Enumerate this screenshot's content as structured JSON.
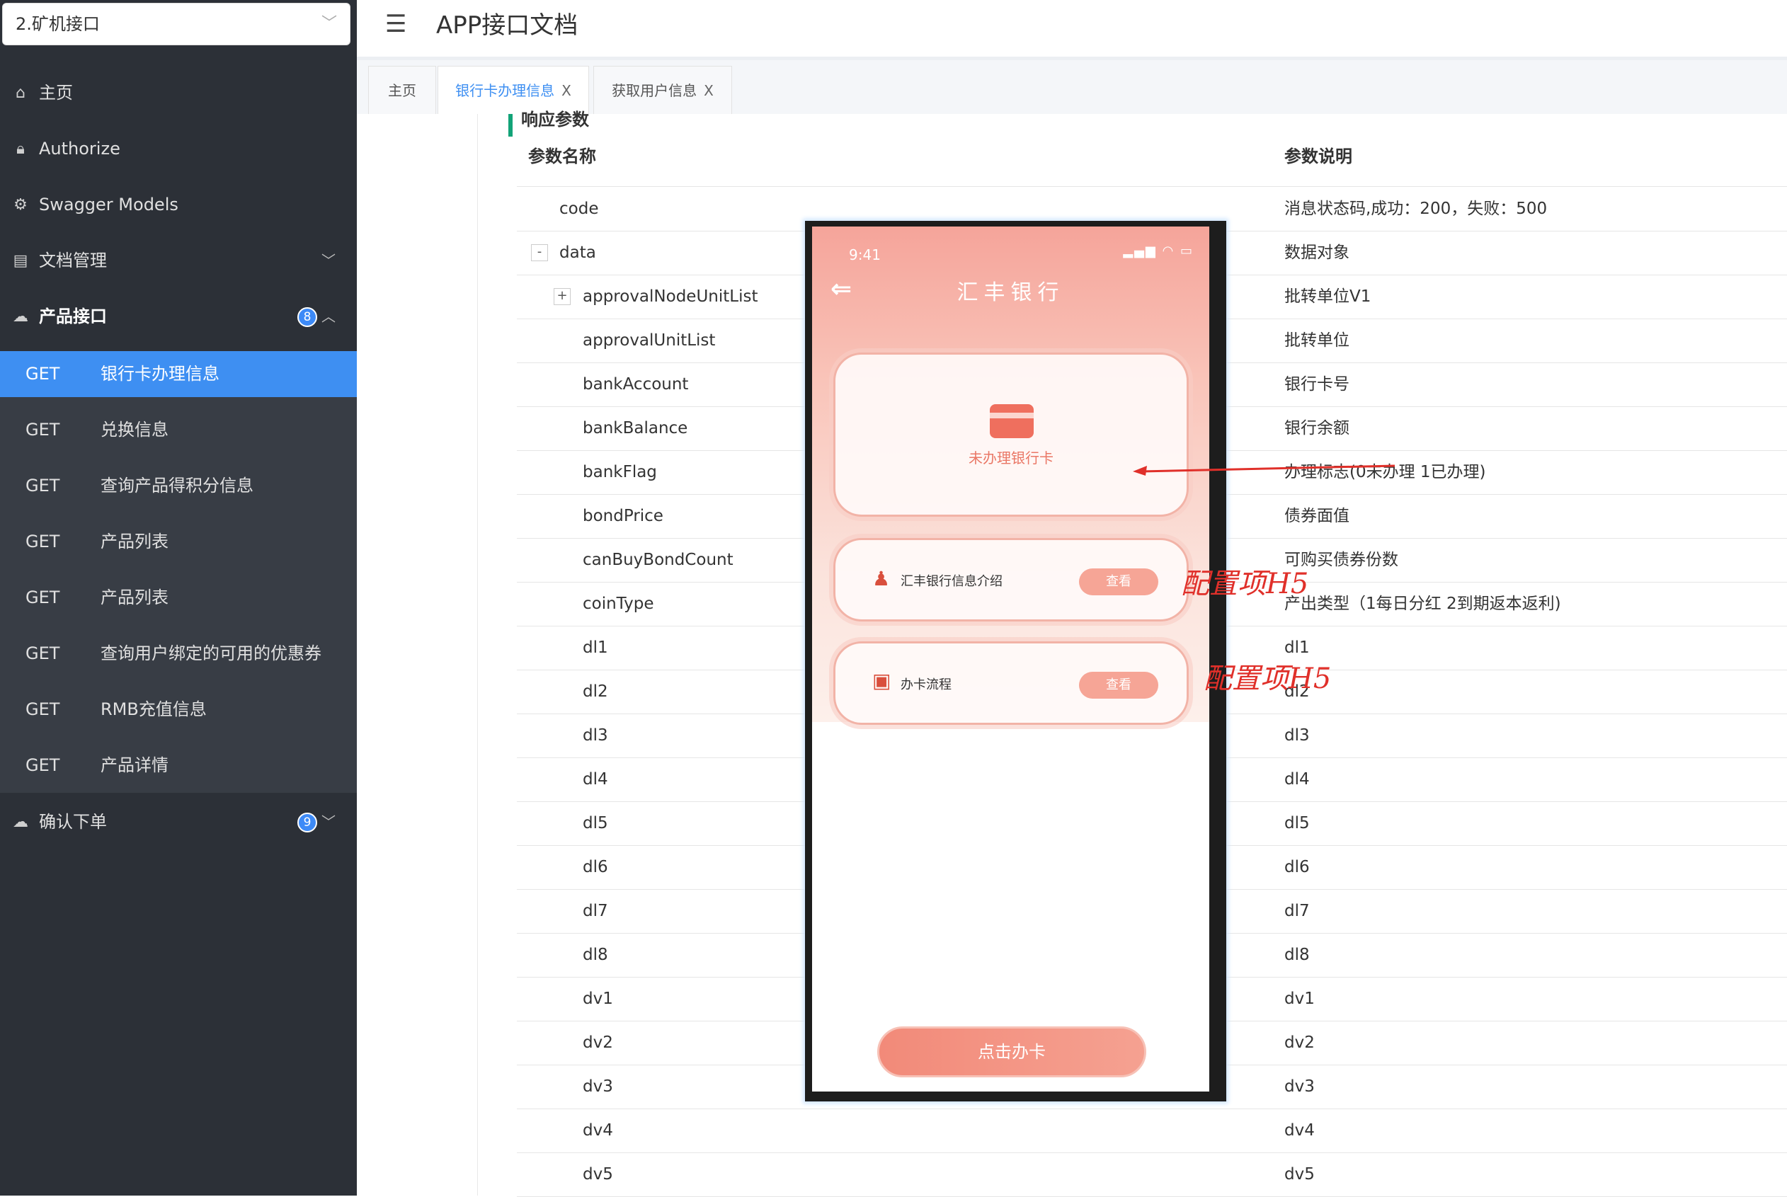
{
  "sidebar": {
    "select_value": "2.矿机接口",
    "items": [
      {
        "label": "主页"
      },
      {
        "label": "Authorize"
      },
      {
        "label": "Swagger Models"
      },
      {
        "label": "文档管理"
      },
      {
        "label": "产品接口",
        "badge": "8"
      },
      {
        "label": "确认下单",
        "badge": "9"
      }
    ],
    "sub_items": [
      {
        "method": "GET",
        "label": "银行卡办理信息"
      },
      {
        "method": "GET",
        "label": "兑换信息"
      },
      {
        "method": "GET",
        "label": "查询产品得积分信息"
      },
      {
        "method": "GET",
        "label": "产品列表"
      },
      {
        "method": "GET",
        "label": "产品列表"
      },
      {
        "method": "GET",
        "label": "查询用户绑定的可用的优惠券"
      },
      {
        "method": "GET",
        "label": "RMB充值信息"
      },
      {
        "method": "GET",
        "label": "产品详情"
      }
    ]
  },
  "header": {
    "title": "APP接口文档"
  },
  "tabs": [
    {
      "label": "主页"
    },
    {
      "label": "银行卡办理信息",
      "close": "X"
    },
    {
      "label": "获取用户信息",
      "close": "X"
    }
  ],
  "content": {
    "section_title": "响应参数",
    "col_name": "参数名称",
    "col_desc": "参数说明",
    "rows": [
      {
        "name": "code",
        "desc": "消息状态码,成功：200，失败：500"
      },
      {
        "name": "data",
        "desc": "数据对象",
        "toggle": "-"
      },
      {
        "name": "approvalNodeUnitList",
        "desc": "批转单位V1",
        "toggle": "+"
      },
      {
        "name": "approvalUnitList",
        "desc": "批转单位"
      },
      {
        "name": "bankAccount",
        "desc": "银行卡号"
      },
      {
        "name": "bankBalance",
        "desc": "银行余额"
      },
      {
        "name": "bankFlag",
        "desc": "办理标志(0未办理 1已办理)"
      },
      {
        "name": "bondPrice",
        "desc": "债券面值"
      },
      {
        "name": "canBuyBondCount",
        "desc": "可购买债券份数"
      },
      {
        "name": "coinType",
        "desc": "产出类型（1每日分红 2到期返本返利)"
      },
      {
        "name": "dl1",
        "desc": "dl1"
      },
      {
        "name": "dl2",
        "desc": "dl2"
      },
      {
        "name": "dl3",
        "desc": "dl3"
      },
      {
        "name": "dl4",
        "desc": "dl4"
      },
      {
        "name": "dl5",
        "desc": "dl5"
      },
      {
        "name": "dl6",
        "desc": "dl6"
      },
      {
        "name": "dl7",
        "desc": "dl7"
      },
      {
        "name": "dl8",
        "desc": "dl8"
      },
      {
        "name": "dv1",
        "desc": "dv1"
      },
      {
        "name": "dv2",
        "desc": "dv2"
      },
      {
        "name": "dv3",
        "desc": "dv3"
      },
      {
        "name": "dv4",
        "desc": "dv4"
      },
      {
        "name": "dv5",
        "desc": "dv5"
      }
    ]
  },
  "phone": {
    "time": "9:41",
    "title": "汇丰银行",
    "card_text": "未办理银行卡",
    "item1": "汇丰银行信息介绍",
    "item2": "办卡流程",
    "view": "查看",
    "button": "点击办卡"
  },
  "annotations": {
    "label1": "配置项H5",
    "label2": "配置项H5"
  }
}
